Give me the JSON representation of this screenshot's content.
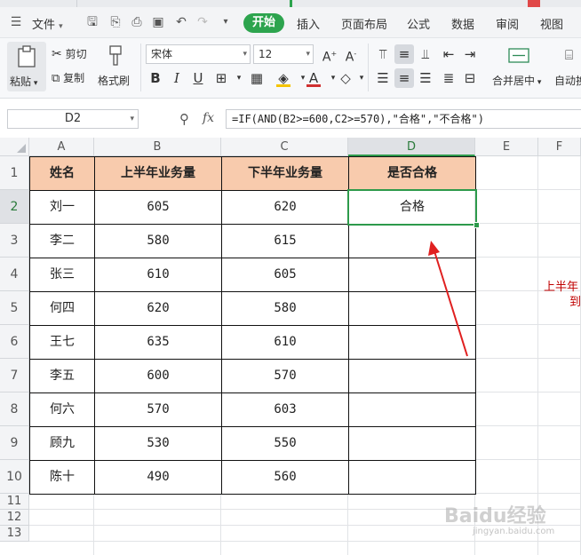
{
  "tabs": {
    "items": [
      {
        "label": "",
        "color": "#2d6fd6"
      },
      {
        "label": "",
        "color": "#ffffff"
      },
      {
        "label": "",
        "color": "#ffffff"
      },
      {
        "label": "",
        "color": "#ffffff"
      }
    ]
  },
  "menu": {
    "file_label": "文件",
    "start_label": "开始",
    "items": [
      "插入",
      "页面布局",
      "公式",
      "数据",
      "审阅",
      "视图"
    ]
  },
  "ribbon": {
    "paste_label": "粘贴",
    "cut_label": "剪切",
    "copy_label": "复制",
    "format_painter_label": "格式刷",
    "font_name": "宋体",
    "font_size": "12",
    "bold_label": "B",
    "italic_label": "I",
    "underline_label": "U",
    "merge_label": "合并居中",
    "autowrap_label": "自动换",
    "font_color": "#d03030",
    "fill_color": "#f5c400"
  },
  "formula_bar": {
    "name_box": "D2",
    "fx_label": "fx",
    "formula": "=IF(AND(B2>=600,C2>=570),\"合格\",\"不合格\")"
  },
  "sheet": {
    "columns": [
      "A",
      "B",
      "C",
      "D",
      "E",
      "F"
    ],
    "active_column": "D",
    "active_cell": "D2",
    "rows": [
      "1",
      "2",
      "3",
      "4",
      "5",
      "6",
      "7",
      "8",
      "9",
      "10",
      "11",
      "12",
      "13"
    ],
    "header_row": [
      "姓名",
      "上半年业务量",
      "下半年业务量",
      "是否合格"
    ],
    "data": [
      [
        "刘一",
        "605",
        "620",
        "合格"
      ],
      [
        "李二",
        "580",
        "615",
        ""
      ],
      [
        "张三",
        "610",
        "605",
        ""
      ],
      [
        "何四",
        "620",
        "580",
        ""
      ],
      [
        "王七",
        "635",
        "610",
        ""
      ],
      [
        "李五",
        "600",
        "570",
        ""
      ],
      [
        "何六",
        "570",
        "603",
        ""
      ],
      [
        "顾九",
        "530",
        "550",
        ""
      ],
      [
        "陈十",
        "490",
        "560",
        ""
      ]
    ],
    "header_fill": "#f8cbad",
    "side_note_line1": "上半年",
    "side_note_line2": "到",
    "side_note_color": "#c00000",
    "watermark": "Baidu经验",
    "watermark_sub": "jingyan.baidu.com"
  }
}
